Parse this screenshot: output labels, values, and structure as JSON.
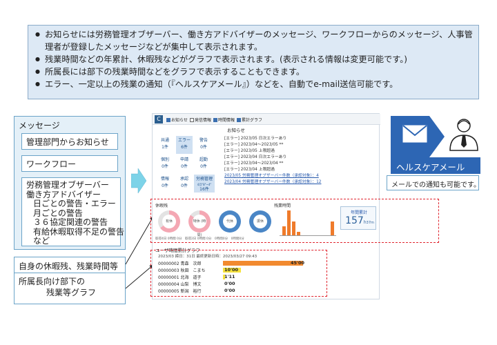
{
  "info_bullets": [
    "お知らせには労務管理オブザーバー、働き方アドバイザーのメッセージ、ワークフローからのメッセージ、人事管理者が登録したメッセージなどが集中して表示されます。",
    "残業時間などの年累計、休暇残などがグラフで表示されます。(表示される情報は変更可能です。)",
    "所属長には部下の残業時間などをグラフで表示することもできます。",
    "エラー、一定以上の残業の通知（『ヘルスケアメール』）などを、自動でe-mail送信可能です。"
  ],
  "message_box": {
    "title": "メッセージ",
    "items": [
      "管理部門からお知らせ",
      "ワークフロー"
    ],
    "observer_lines": [
      "労務管理オブザーバー",
      "働き方アドバイザー",
      "日ごとの警告・エラー",
      "月ごとの警告",
      "３６協定関連の警告",
      "有給休暇取得不足の警告",
      "など"
    ]
  },
  "labels": {
    "self": "自身の休暇残、残業時間等",
    "sub_line1": "所属長向け部下の",
    "sub_line2": "残業等グラフ"
  },
  "toolbar": {
    "logo": "C",
    "checks": [
      {
        "label": "お知らせ",
        "on": true
      },
      {
        "label": "発信情報",
        "on": false
      },
      {
        "label": "時間情報",
        "on": true
      },
      {
        "label": "累計グラフ",
        "on": true
      }
    ]
  },
  "tiles": [
    {
      "label": "共通",
      "count": "1件"
    },
    {
      "label": "エラー",
      "count": "6件"
    },
    {
      "label": "警告",
      "count": "0件"
    },
    {
      "label": "個別",
      "count": "0件"
    },
    {
      "label": "申請",
      "count": "0件"
    },
    {
      "label": "超勤",
      "count": "0件"
    },
    {
      "label": "情報",
      "count": "0件"
    },
    {
      "label": "承認",
      "count": "0件"
    },
    {
      "label": "労務管理",
      "count": "16件"
    }
  ],
  "notices": {
    "title": "お知らせ",
    "lines": [
      "[エラー] 2023/05 日次エラーあり",
      "[エラー] 2023/04～2023/05 **",
      "[エラー] 2023/05 上限超過",
      "[エラー] 2023/04 日次エラーあり",
      "[エラー] 2023/04～2023/04 **",
      "[エラー] 2023/04 上限超過"
    ],
    "links": [
      "2023/05 労務管理オブザーバー件数（承認対象）：4",
      "2023/04 労務管理オブザーバー件数（承認対象）：12"
    ]
  },
  "charts": {
    "leave_label": "休暇残",
    "overtime_label": "残業時間",
    "donuts": [
      {
        "label": "有休",
        "fraction": 0.65
      },
      {
        "label": "特休\n(時間)",
        "fraction": 0.85
      },
      {
        "label": "代休",
        "fraction": 1.0
      },
      {
        "label": "振休",
        "fraction": 1.0
      }
    ],
    "overtime_bars": [
      0.35,
      1.0,
      0.55,
      0.15,
      0.0,
      0.0,
      0.0,
      0.0,
      0.0,
      0.0,
      0.55,
      0.0
    ],
    "annual_label": "年間累計",
    "annual_value": "157",
    "annual_h": "h",
    "annual_m": "37m"
  },
  "user_graph": {
    "title": "ユーザ時間累計グラフ",
    "subtitle": "2023/03 締日：31日 最終更新日時：2023/03/27 09:43",
    "rows": [
      {
        "id": "00000002",
        "name": "青森　次郎",
        "value": "45'00",
        "fraction": 1.0,
        "color": "#f28a2f"
      },
      {
        "id": "00000003",
        "name": "秋田　こまち",
        "value": "10'00",
        "fraction": 0.22,
        "color": "#f6e23d"
      },
      {
        "id": "00000001",
        "name": "北海　道子",
        "value": "1'11",
        "fraction": 0.03,
        "color": "#f6e23d"
      },
      {
        "id": "00000004",
        "name": "山梨　博文",
        "value": "0'00",
        "fraction": 0,
        "color": "#ffffff"
      },
      {
        "id": "00000005",
        "name": "新潟　裕行",
        "value": "0'00",
        "fraction": 0,
        "color": "#ffffff"
      }
    ]
  },
  "healthcare": {
    "title": "ヘルスケアメール",
    "note": "メールでの通知も可能です。"
  }
}
